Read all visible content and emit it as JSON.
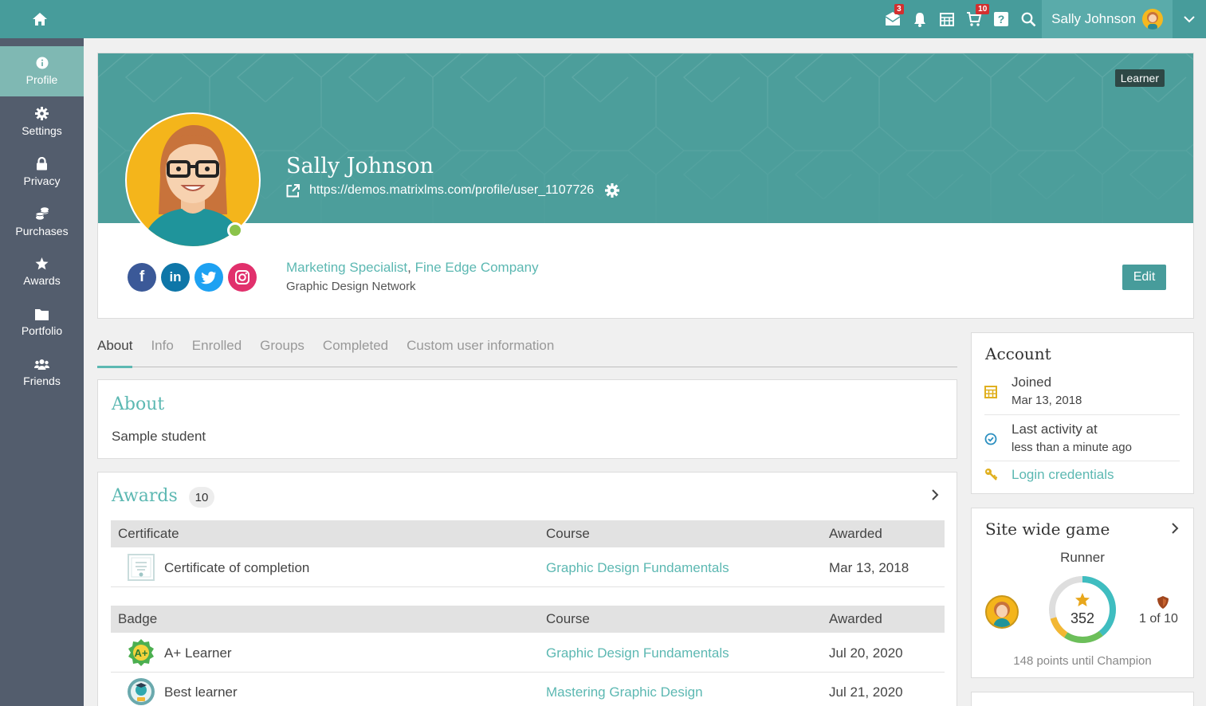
{
  "topbar": {
    "messages_badge": "3",
    "cart_badge": "10",
    "user_name": "Sally Johnson"
  },
  "sidebar": {
    "items": [
      {
        "label": "Profile",
        "icon": "info-icon"
      },
      {
        "label": "Settings",
        "icon": "gear-icon"
      },
      {
        "label": "Privacy",
        "icon": "lock-icon"
      },
      {
        "label": "Purchases",
        "icon": "coins-icon"
      },
      {
        "label": "Awards",
        "icon": "star-icon"
      },
      {
        "label": "Portfolio",
        "icon": "folder-icon"
      },
      {
        "label": "Friends",
        "icon": "users-icon"
      }
    ]
  },
  "profile": {
    "role_tag": "Learner",
    "name": "Sally Johnson",
    "url": "https://demos.matrixlms.com/profile/user_1107726",
    "job_title": "Marketing Specialist",
    "separator": ",",
    "company": "Fine Edge Company",
    "network": "Graphic Design Network",
    "edit_label": "Edit",
    "socials": [
      "facebook",
      "linkedin",
      "twitter",
      "instagram"
    ]
  },
  "tabs": [
    "About",
    "Info",
    "Enrolled",
    "Groups",
    "Completed",
    "Custom user information"
  ],
  "about": {
    "title": "About",
    "text": "Sample student"
  },
  "awards": {
    "title": "Awards",
    "count": "10",
    "cert_headers": [
      "Certificate",
      "Course",
      "Awarded"
    ],
    "certificates": [
      {
        "name": "Certificate of completion",
        "course": "Graphic Design Fundamentals",
        "date": "Mar 13, 2018"
      }
    ],
    "badge_headers": [
      "Badge",
      "Course",
      "Awarded"
    ],
    "badges": [
      {
        "name": "A+ Learner",
        "course": "Graphic Design Fundamentals",
        "date": "Jul 20, 2020"
      },
      {
        "name": "Best learner",
        "course": "Mastering Graphic Design",
        "date": "Jul 21, 2020"
      }
    ]
  },
  "account": {
    "title": "Account",
    "joined_label": "Joined",
    "joined_value": "Mar 13, 2018",
    "activity_label": "Last activity at",
    "activity_value": "less than a minute ago",
    "credentials_label": "Login credentials"
  },
  "game": {
    "title": "Site wide game",
    "rank": "Runner",
    "points": "352",
    "placing": "1 of 10",
    "until": "148 points until Champion",
    "progress_fraction": 0.704
  },
  "colors": {
    "teal": "#479c9b",
    "accent": "#5cb8b2",
    "sidebar": "#535d6d"
  }
}
